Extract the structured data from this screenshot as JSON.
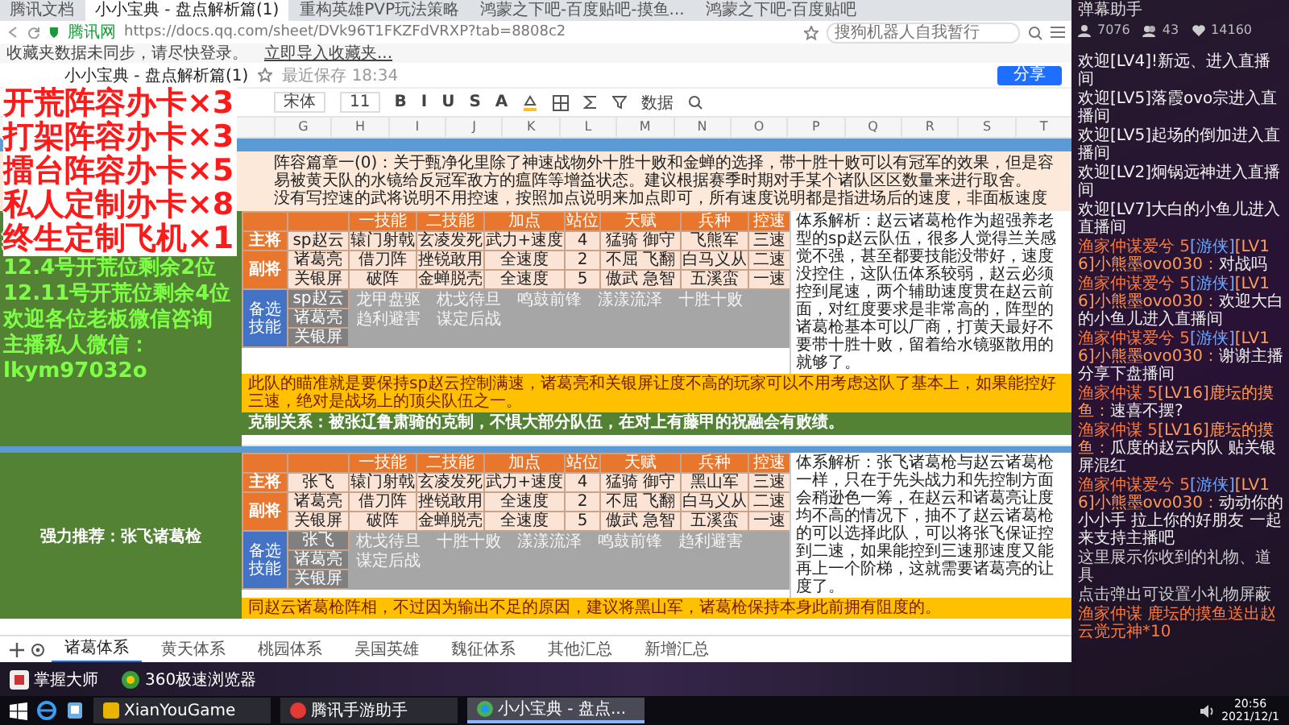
{
  "browser": {
    "tabs": [
      {
        "label": "腾讯文档",
        "selected": false
      },
      {
        "label": "小小宝典 - 盘点解析篇(1)",
        "selected": true
      },
      {
        "label": "重构英雄PVP玩法策略",
        "selected": false
      },
      {
        "label": "鸿蒙之下吧-百度贴吧-摸鱼...",
        "selected": false
      },
      {
        "label": "鸿蒙之下吧-百度贴吧",
        "selected": false
      }
    ],
    "secure_label": "腾讯网",
    "url": "https://docs.qq.com/sheet/DVk96T1FKZFdVRXP?tab=8808c2",
    "search_placeholder": "搜狗机器人自我暂行",
    "bookmarks": [
      "收藏夹数据未同步，请尽快登录。",
      "立即导入收藏夹..."
    ]
  },
  "doc": {
    "title": "小小宝典 - 盘点解析篇(1)",
    "saved": "最近保存 18:34",
    "share": "分享"
  },
  "toolbar": {
    "font": "宋体",
    "size": "11",
    "format": [
      "B",
      "I",
      "U",
      "S",
      "A"
    ],
    "data_label": "数据"
  },
  "columns": [
    "G",
    "H",
    "I",
    "J",
    "K",
    "L",
    "M",
    "N",
    "O",
    "P",
    "Q",
    "R",
    "S",
    "T"
  ],
  "promo": {
    "red_lines": [
      "开荒阵容办卡×3",
      "打架阵容办卡×3",
      "擂台阵容办卡×5",
      "私人定制办卡×8",
      "终生定制飞机×1"
    ],
    "green_lines": [
      "12.4号开荒位剩余2位",
      "12.11号开荒位剩余4位",
      "欢迎各位老板微信咨询",
      "主播私人微信：",
      "lkym97032o"
    ]
  },
  "notes": [
    "阵容篇章一(0)：关于甄净化里除了神速战物外十胜十败和金蝉的选择，带十胜十败可以有冠军的效果，但是容易被黄天队的水镜给反冠军敌方的瘟阵等增益状态。建议根据赛季时期对手某个诸队区区数量来进行取舍。",
    "没有写控速的武将说明不用控速，按照加点说明来加点即可，所有速度说明都是指进场后的速度，非面板速度"
  ],
  "sections": [
    {
      "headers": [
        "一技能",
        "二技能",
        "加点",
        "站位",
        "天赋",
        "兵种",
        "控速"
      ],
      "groups": [
        {
          "role": "主将",
          "rows": [
            [
              "sp赵云",
              "辕门射戟",
              "玄凌发死",
              "武力+速度",
              "4",
              "猛骑 御守",
              "飞熊军",
              "三速"
            ]
          ]
        },
        {
          "role": "副将",
          "rows": [
            [
              "诸葛亮",
              "借刀阵",
              "挫锐敢用",
              "全速度",
              "2",
              "不屈 飞翻",
              "白马义从",
              "二速"
            ],
            [
              "关银屏",
              "破阵",
              "金蝉脱壳",
              "全速度",
              "5",
              "傲武 急智",
              "五溪蛮",
              "一速"
            ]
          ]
        }
      ],
      "backup": {
        "label": "备选技能",
        "names": [
          "sp赵云",
          "诸葛亮",
          "关银屏"
        ],
        "skills": [
          "龙甲盘驱",
          "枕戈待旦",
          "鸣鼓前锋",
          "漾漾流泽",
          "十胜十败",
          "趋利避害",
          "谋定后战"
        ]
      },
      "analysis": "体系解析：赵云诸葛枪作为超强养老型的sp赵云队伍，很多人觉得兰关感觉不强，甚至都要技能没带好，速度没控住，这队伍体系较弱，赵云必须控到尾速，两个辅助速度贯在赵云前面，对红度要求是非常高的，阵型的诸葛枪基本可以厂商，打黄天最好不要带十胜十败，留着给水镜驱散用的就够了。",
      "summary": "此队的瞄准就是要保持sp赵云控制满速，诸葛亮和关银屏让度不高的玩家可以不用考虑这队了基本上，如果能控好三速，绝对是战场上的顶尖队伍之一。",
      "relation": "克制关系：被张辽鲁肃骑的克制，不惧大部分队伍，在对上有藤甲的祝融会有败绩。"
    },
    {
      "side": "强力推荐：张飞诸葛检",
      "headers": [
        "一技能",
        "二技能",
        "加点",
        "站位",
        "天赋",
        "兵种",
        "控速"
      ],
      "groups": [
        {
          "role": "主将",
          "rows": [
            [
              "张飞",
              "辕门射戟",
              "玄凌发死",
              "武力+速度",
              "4",
              "猛骑 御守",
              "黑山军",
              "三速"
            ]
          ]
        },
        {
          "role": "副将",
          "rows": [
            [
              "诸葛亮",
              "借刀阵",
              "挫锐敢用",
              "全速度",
              "2",
              "不屈 飞翻",
              "白马义从",
              "二速"
            ],
            [
              "关银屏",
              "破阵",
              "金蝉脱壳",
              "全速度",
              "5",
              "傲武 急智",
              "五溪蛮",
              "一速"
            ]
          ]
        }
      ],
      "backup": {
        "label": "备选技能",
        "names": [
          "张飞",
          "诸葛亮",
          "关银屏"
        ],
        "skills": [
          "枕戈待旦",
          "十胜十败",
          "漾漾流泽",
          "鸣鼓前锋",
          "趋利避害",
          "谋定后战"
        ]
      },
      "analysis": "体系解析：张飞诸葛枪与赵云诸葛枪一样，只在于先头战力和先控制方面会稍逊色一筹，在赵云和诸葛亮让度均不高的情况下，抽不了赵云诸葛枪的可以选择此队，可以将张飞保证控到二速，如果能控到三速那速度又能再上一个阶梯，这就需要诸葛亮的让度了。",
      "summary": "同赵云诸葛枪阵相，不过因为输出不足的原因，建议将黑山军，诸葛枪保持本身此前拥有阻度的。"
    }
  ],
  "sheet_tabs": [
    {
      "label": "诸葛体系",
      "selected": true
    },
    {
      "label": "黄天体系",
      "selected": false
    },
    {
      "label": "桃园体系",
      "selected": false
    },
    {
      "label": "吴国英雄",
      "selected": false
    },
    {
      "label": "魏征体系",
      "selected": false
    },
    {
      "label": "其他汇总",
      "selected": false
    },
    {
      "label": "新增汇总",
      "selected": false
    }
  ],
  "desktop": {
    "icons": [
      "掌握大师",
      "360极速浏览器"
    ]
  },
  "chat": {
    "title": "弹幕助手",
    "stats": [
      "7076",
      "43",
      "14160"
    ],
    "messages": [
      {
        "kind": "enter",
        "text": "欢迎[LV4]!新远、进入直播间"
      },
      {
        "kind": "enter",
        "text": "欢迎[LV5]落霞ovo宗进入直播间"
      },
      {
        "kind": "enter",
        "text": "欢迎[LV5]起场的倒加进入直播间"
      },
      {
        "kind": "enter",
        "text": "欢迎[LV2]炯锅远神进入直播间"
      },
      {
        "kind": "enter",
        "text": "欢迎[LV7]大白的小鱼儿进入直播间"
      },
      {
        "kind": "msg",
        "fan": "渔家仲谋爱兮 5",
        "tag": "[游侠]",
        "user": "[LV16]小熊墨ovo030：",
        "text": "对战吗"
      },
      {
        "kind": "msg",
        "fan": "渔家仲谋爱兮 5",
        "tag": "[游侠]",
        "user": "[LV16]小熊墨ovo030：",
        "text": "欢迎大白的小鱼儿进入直播间"
      },
      {
        "kind": "msg",
        "fan": "渔家仲谋爱兮 5",
        "tag": "[游侠]",
        "user": "[LV16]小熊墨ovo030：",
        "text": "谢谢主播分享下盘播间"
      },
      {
        "kind": "msg",
        "fan": "渔家仲谋 5",
        "user": "[LV16]鹿坛的摸鱼：",
        "text": "速喜不摆?"
      },
      {
        "kind": "msg",
        "fan": "渔家仲谋 5",
        "user": "[LV16]鹿坛的摸鱼：",
        "text": "瓜度的赵云内队 贴关银屏混红"
      },
      {
        "kind": "msg",
        "fan": "渔家仲谋爱兮 5",
        "tag": "[游侠]",
        "user": "[LV16]小熊墨ovo030：",
        "text": "动动你的小小手 拉上你的好朋友 一起来支持主播吧"
      },
      {
        "kind": "system",
        "text": "这里展示你收到的礼物、道具"
      },
      {
        "kind": "system",
        "text": "点击弹出可设置小礼物屏蔽"
      },
      {
        "kind": "gift",
        "text": "渔家仲谋 鹿坛的摸鱼送出赵云觉元神*10"
      }
    ]
  },
  "taskbar": {
    "apps": [
      {
        "label": "XianYouGame",
        "selected": false
      },
      {
        "label": "腾讯手游助手",
        "selected": false
      },
      {
        "label": "小小宝典 - 盘点...",
        "selected": true
      }
    ],
    "time": "20:56",
    "date": "2021/12/1"
  }
}
